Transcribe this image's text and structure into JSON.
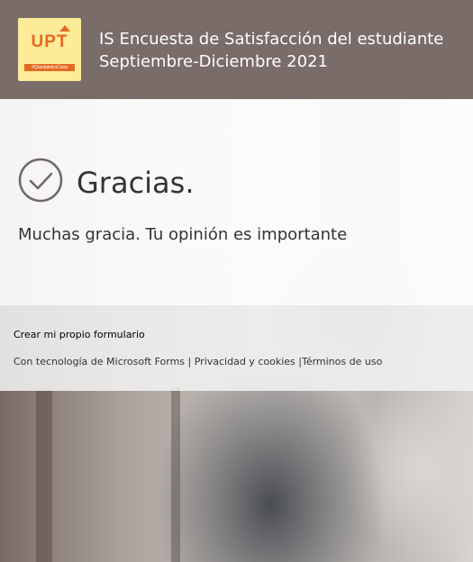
{
  "header": {
    "logo": {
      "text": "UPT",
      "tagline": "#QuedateEnCasa",
      "bg_color": "#fdeb9a",
      "accent_color": "#e46a22"
    },
    "title_line1": "IS Encuesta de Satisfacción del estudiante",
    "title_line2": "Septiembre-Diciembre 2021",
    "bg_color": "#796c69"
  },
  "confirmation": {
    "icon": "check-circle-icon",
    "heading": "Gracias.",
    "message": "Muchas gracia. Tu opinión es importante"
  },
  "footer": {
    "create_form_link": "Crear mi propio formulario",
    "powered_by_text": "Con tecnología de Microsoft Forms",
    "separator": "|",
    "privacy_link": "Privacidad y cookies",
    "terms_link": "Términos de uso",
    "link_color": "#0f4fa3"
  }
}
